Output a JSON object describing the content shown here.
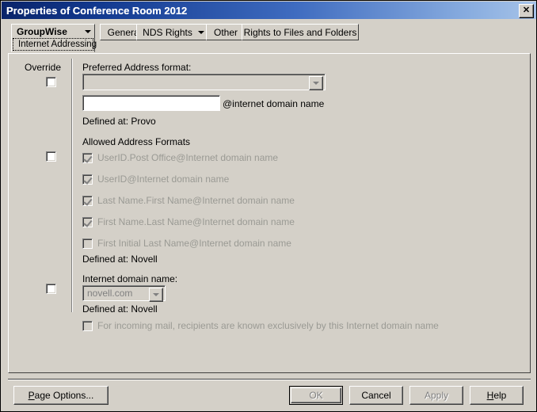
{
  "window": {
    "title": "Properties of Conference Room 2012",
    "close_label": "✕"
  },
  "tabs": {
    "primary": {
      "label": "GroupWise",
      "sub_label": "Internet Addressing",
      "dropdown_icon": "chevron-down-icon"
    },
    "items": [
      {
        "label": "General",
        "has_dropdown": false
      },
      {
        "label": "NDS Rights",
        "has_dropdown": true
      },
      {
        "label": "Other",
        "has_dropdown": false
      },
      {
        "label": "Rights to Files and Folders",
        "has_dropdown": false
      }
    ]
  },
  "content": {
    "override_header": "Override",
    "preferred_address": {
      "label": "Preferred Address format:",
      "combo_value": "",
      "domain_input_value": "",
      "domain_suffix_label": "@internet domain name",
      "defined_at": "Defined at:  Provo"
    },
    "allowed_formats": {
      "label": "Allowed Address Formats",
      "items": [
        {
          "label": "UserID.Post Office@Internet domain name",
          "checked": true,
          "enabled": false
        },
        {
          "label": "UserID@Internet domain name",
          "checked": true,
          "enabled": false
        },
        {
          "label": "Last Name.First Name@Internet domain name",
          "checked": true,
          "enabled": false
        },
        {
          "label": "First Name.Last Name@Internet domain name",
          "checked": true,
          "enabled": false
        },
        {
          "label": "First Initial Last Name@Internet domain name",
          "checked": false,
          "enabled": false
        }
      ],
      "defined_at": "Defined at:  Novell"
    },
    "internet_domain": {
      "label": "Internet domain name:",
      "combo_value": "novell.com",
      "defined_at": "Defined at:  Novell",
      "exclusive_checkbox_label": "For incoming mail, recipients are known exclusively by this Internet domain name",
      "exclusive_checked": false
    }
  },
  "footer": {
    "page_options": "Page Options...",
    "ok": "OK",
    "cancel": "Cancel",
    "apply": "Apply",
    "help": "Help"
  },
  "colors": {
    "face": "#d4d0c8",
    "title_start": "#0a246a",
    "title_end": "#a6c3e8",
    "disabled_text": "#9a9a94"
  }
}
